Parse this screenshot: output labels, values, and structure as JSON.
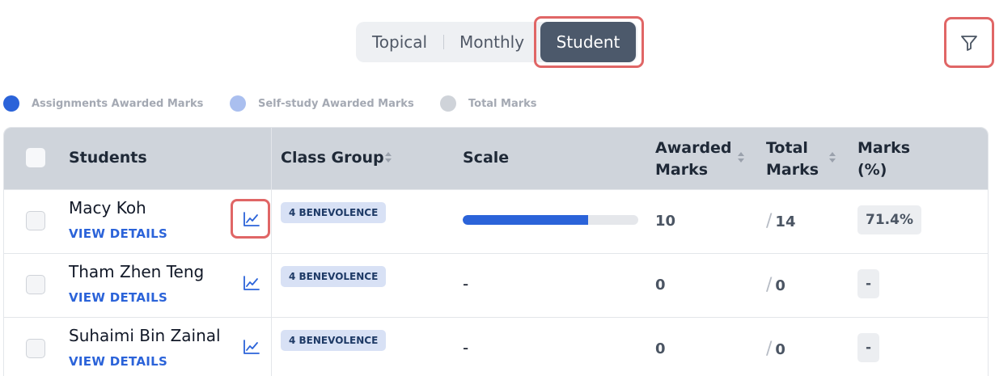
{
  "toggle": {
    "topical": "Topical",
    "monthly": "Monthly",
    "student": "Student"
  },
  "legend": [
    {
      "label": "Assignments Awarded Marks",
      "color": "#2b63d9"
    },
    {
      "label": "Self-study Awarded Marks",
      "color": "#aabfef"
    },
    {
      "label": "Total Marks",
      "color": "#cfd3d9"
    }
  ],
  "table": {
    "headers": {
      "students": "Students",
      "class_group": "Class Group",
      "scale": "Scale",
      "awarded_1": "Awarded",
      "awarded_2": "Marks",
      "total_1": "Total",
      "total_2": "Marks",
      "marks_1": "Marks",
      "marks_2": "(%)"
    },
    "rows": [
      {
        "name": "Macy Koh",
        "view": "VIEW DETAILS",
        "class": "4 BENEVOLENCE",
        "scale_fraction": 0.714,
        "scale_text": "",
        "awarded": "10",
        "total": "14",
        "pct": "71.4%"
      },
      {
        "name": "Tham Zhen Teng",
        "view": "VIEW DETAILS",
        "class": "4 BENEVOLENCE",
        "scale_text": "-",
        "awarded": "0",
        "total": "0",
        "pct": "-"
      },
      {
        "name": "Suhaimi Bin Zainal",
        "view": "VIEW DETAILS",
        "class": "4 BENEVOLENCE",
        "scale_text": "-",
        "awarded": "0",
        "total": "0",
        "pct": "-"
      }
    ],
    "slash": "/"
  },
  "colors": {
    "accent": "#2b63d9",
    "active_toggle": "#4c596b",
    "highlight": "#e06666"
  }
}
